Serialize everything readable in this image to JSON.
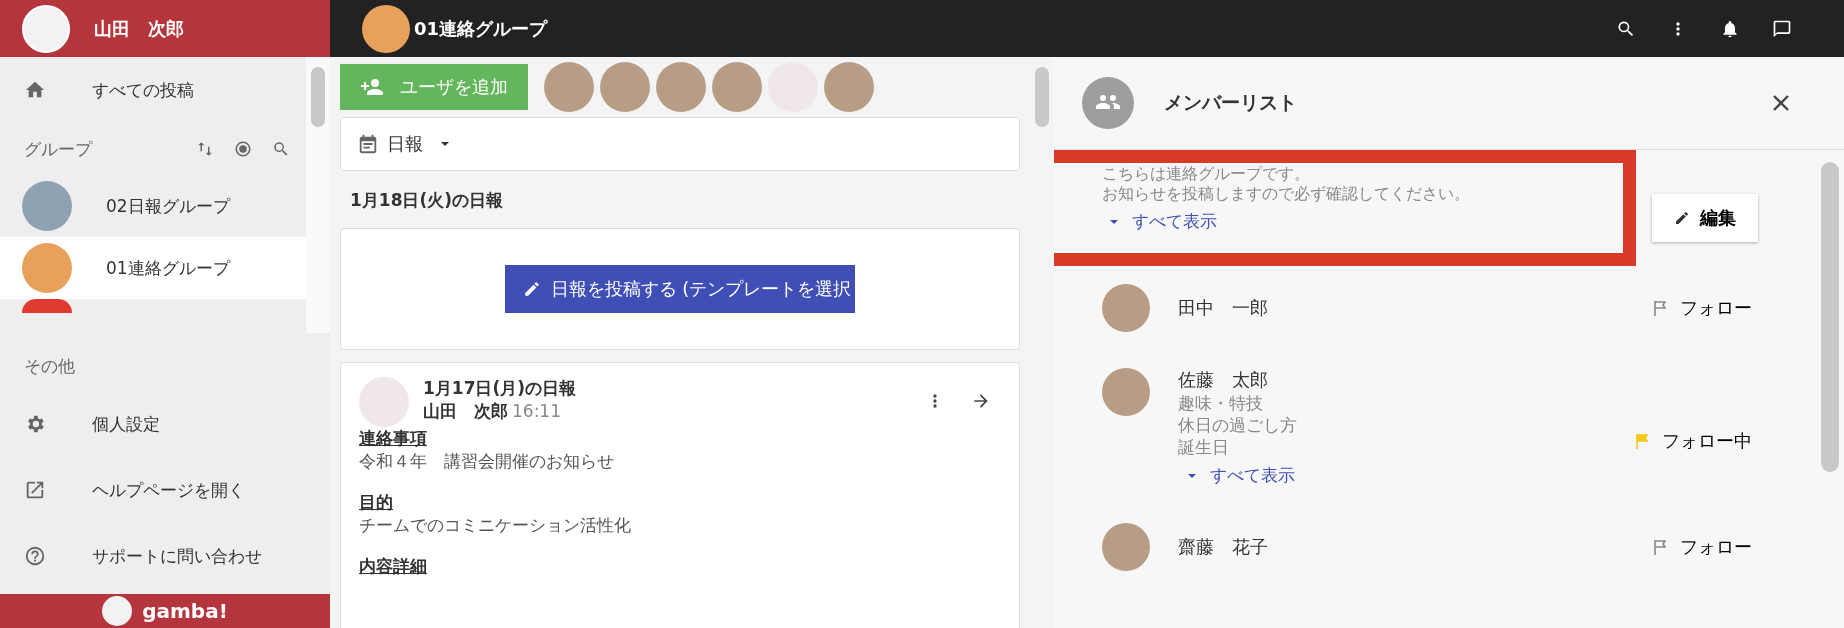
{
  "user": {
    "name": "山田　次郎"
  },
  "sidebar": {
    "nav": [
      {
        "label": "すべての投稿"
      }
    ],
    "groups_title": "グループ",
    "groups": [
      {
        "name": "02日報グループ",
        "kind": "photo",
        "selected": false
      },
      {
        "name": "01連絡グループ",
        "kind": "notes",
        "selected": true
      }
    ],
    "other_title": "その他",
    "other_items": [
      {
        "label": "個人設定"
      },
      {
        "label": "ヘルプページを開く"
      },
      {
        "label": "サポートに問い合わせ"
      }
    ],
    "footer": {
      "logo": "gamba!"
    }
  },
  "header": {
    "group_name": "01連絡グループ"
  },
  "members_bar": {
    "add_button": "ユーザを追加",
    "avatars": [
      {
        "kind": "photo"
      },
      {
        "kind": "photo"
      },
      {
        "kind": "photo"
      },
      {
        "kind": "photo"
      },
      {
        "kind": "cartoon"
      },
      {
        "kind": "photo"
      }
    ]
  },
  "filter": {
    "label": "日報"
  },
  "today": {
    "heading": "1月18日(火)の日報",
    "post_button": "日報を投稿する (テンプレートを選択"
  },
  "post": {
    "title": "1月17日(月)の日報",
    "author": "山田　次郎",
    "time": "16:11",
    "sections": [
      {
        "heading": "連絡事項",
        "body": "令和４年　講習会開催のお知らせ"
      },
      {
        "heading": "目的",
        "body": "チームでのコミニケーション活性化"
      },
      {
        "heading": "内容詳細"
      }
    ]
  },
  "member_panel": {
    "title": "メンバーリスト",
    "description": [
      "こちらは連絡グループです。",
      "お知らせを投稿しますので必ず確認してください。"
    ],
    "show_all": "すべて表示",
    "highlighted": true,
    "edit_button": "編集",
    "members": [
      {
        "name": "田中　一郎",
        "follow_label": "フォロー",
        "following": false
      },
      {
        "name": "佐藤　太郎",
        "details": [
          "趣味・特技",
          "休日の過ごし方",
          "誕生日"
        ],
        "show_all": "すべて表示",
        "follow_label": "フォロー中",
        "following": true
      },
      {
        "name": "齋藤　花子",
        "follow_label": "フォロー",
        "following": false
      }
    ]
  }
}
